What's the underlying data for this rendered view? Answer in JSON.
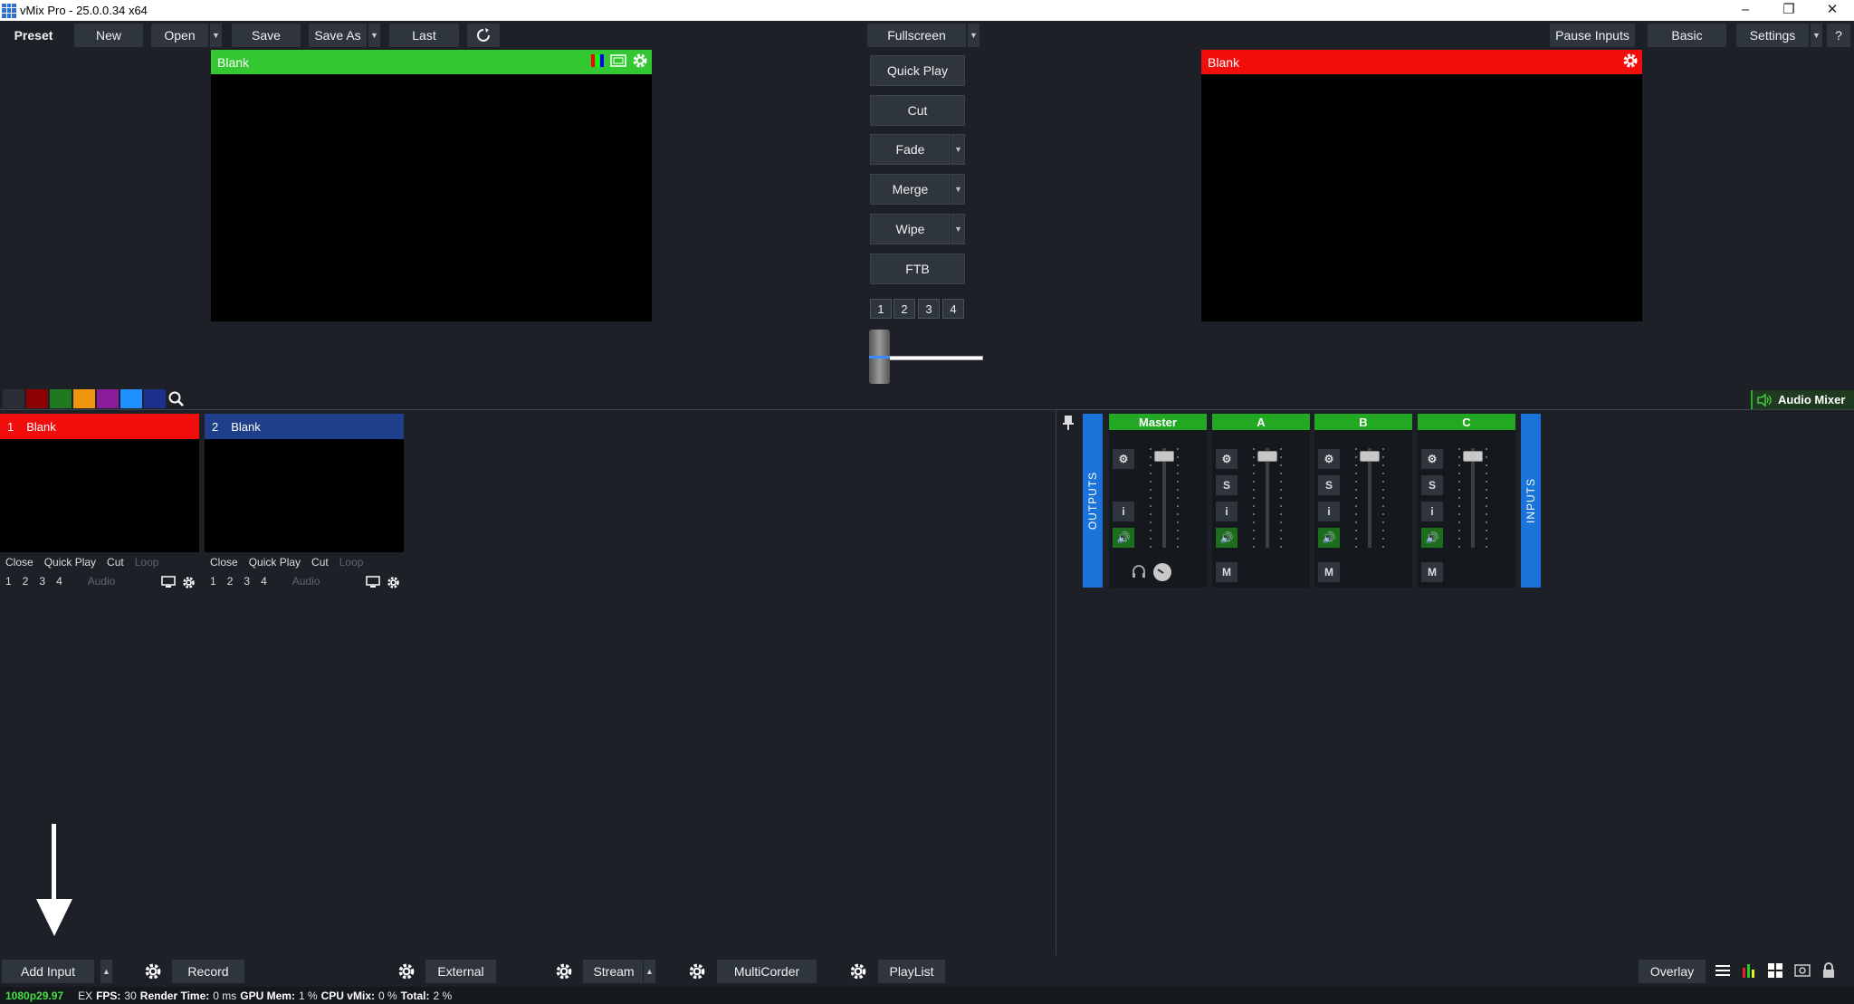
{
  "window": {
    "title": "vMix Pro - 25.0.0.34 x64"
  },
  "toolbar": {
    "preset": "Preset",
    "new": "New",
    "open": "Open",
    "save": "Save",
    "save_as": "Save As",
    "last": "Last",
    "fullscreen": "Fullscreen",
    "pause_inputs": "Pause Inputs",
    "basic": "Basic",
    "settings": "Settings",
    "help": "?"
  },
  "preview": {
    "title": "Blank"
  },
  "output": {
    "title": "Blank"
  },
  "transitions": {
    "quick_play": "Quick Play",
    "cut": "Cut",
    "fade": "Fade",
    "merge": "Merge",
    "wipe": "Wipe",
    "ftb": "FTB",
    "numbers": [
      "1",
      "2",
      "3",
      "4"
    ]
  },
  "colors": {
    "preview_bar": "#33c832",
    "output_bar": "#f20d0d",
    "accent_blue": "#1a73d9"
  },
  "swatches": [
    "#2b2f35",
    "#8b0000",
    "#1f7a1f",
    "#f0950c",
    "#8a1c99",
    "#1e90ff",
    "#1c2f8a"
  ],
  "audio_mixer": {
    "label": "Audio Mixer",
    "outputs_label": "OUTPUTS",
    "inputs_label": "INPUTS",
    "strips": [
      {
        "name": "Master"
      },
      {
        "name": "A",
        "solo": "S",
        "info": "i",
        "mute": "M"
      },
      {
        "name": "B",
        "solo": "S",
        "info": "i",
        "mute": "M"
      },
      {
        "name": "C",
        "solo": "S",
        "info": "i",
        "mute": "M"
      }
    ],
    "master_info": "i"
  },
  "inputs": [
    {
      "number": "1",
      "name": "Blank",
      "close": "Close",
      "quick_play": "Quick Play",
      "cut": "Cut",
      "loop": "Loop",
      "nums": [
        "1",
        "2",
        "3",
        "4"
      ],
      "audio": "Audio"
    },
    {
      "number": "2",
      "name": "Blank",
      "close": "Close",
      "quick_play": "Quick Play",
      "cut": "Cut",
      "loop": "Loop",
      "nums": [
        "1",
        "2",
        "3",
        "4"
      ],
      "audio": "Audio"
    }
  ],
  "bottom": {
    "add_input": "Add Input",
    "record": "Record",
    "external": "External",
    "stream": "Stream",
    "multicorder": "MultiCorder",
    "playlist": "PlayList",
    "overlay": "Overlay"
  },
  "status": {
    "resolution": "1080p29.97",
    "ex": "EX",
    "fps_label": "FPS:",
    "fps": "30",
    "render_label": "Render Time:",
    "render": "0 ms",
    "gpu_label": "GPU Mem:",
    "gpu": "1 %",
    "cpu_label": "CPU vMix:",
    "cpu": "0 %",
    "total_label": "Total:",
    "total": "2 %"
  }
}
